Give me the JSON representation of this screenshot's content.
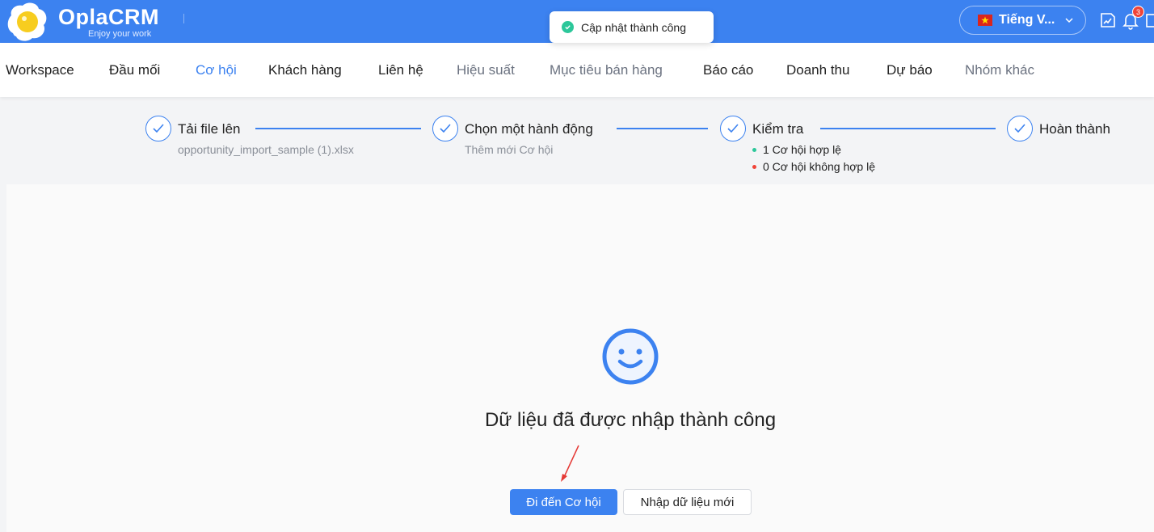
{
  "app": {
    "name": "OplaCRM",
    "tagline": "Enjoy your work",
    "brand_color": "#3c82f0"
  },
  "toast": {
    "text": "Cập nhật thành công",
    "icon": "check-circle-icon",
    "color": "#2cc79a"
  },
  "header": {
    "language": "Tiếng V...",
    "notification_count": "3"
  },
  "nav": {
    "items": [
      {
        "label": "Workspace"
      },
      {
        "label": "Đầu mối"
      },
      {
        "label": "Cơ hội",
        "active": true
      },
      {
        "label": "Khách hàng"
      },
      {
        "label": "Liên hệ"
      },
      {
        "label": "Hiệu suất"
      },
      {
        "label": "Mục tiêu bán hàng"
      },
      {
        "label": "Báo cáo"
      },
      {
        "label": "Doanh thu"
      },
      {
        "label": "Dự báo"
      },
      {
        "label": "Nhóm khác"
      }
    ]
  },
  "steps": [
    {
      "title": "Tải file lên",
      "subtitle": "opportunity_import_sample (1).xlsx"
    },
    {
      "title": "Chọn một hành động",
      "subtitle": "Thêm mới Cơ hội"
    },
    {
      "title": "Kiểm tra",
      "valid": "1 Cơ hội hợp lệ",
      "invalid": "0 Cơ hội không hợp lệ",
      "valid_color": "#2cc79a",
      "invalid_color": "#f04438"
    },
    {
      "title": "Hoàn thành"
    }
  ],
  "result": {
    "message": "Dữ liệu đã được nhập thành công",
    "primary_button": "Đi đến Cơ hội",
    "secondary_button": "Nhập dữ liệu mới"
  }
}
